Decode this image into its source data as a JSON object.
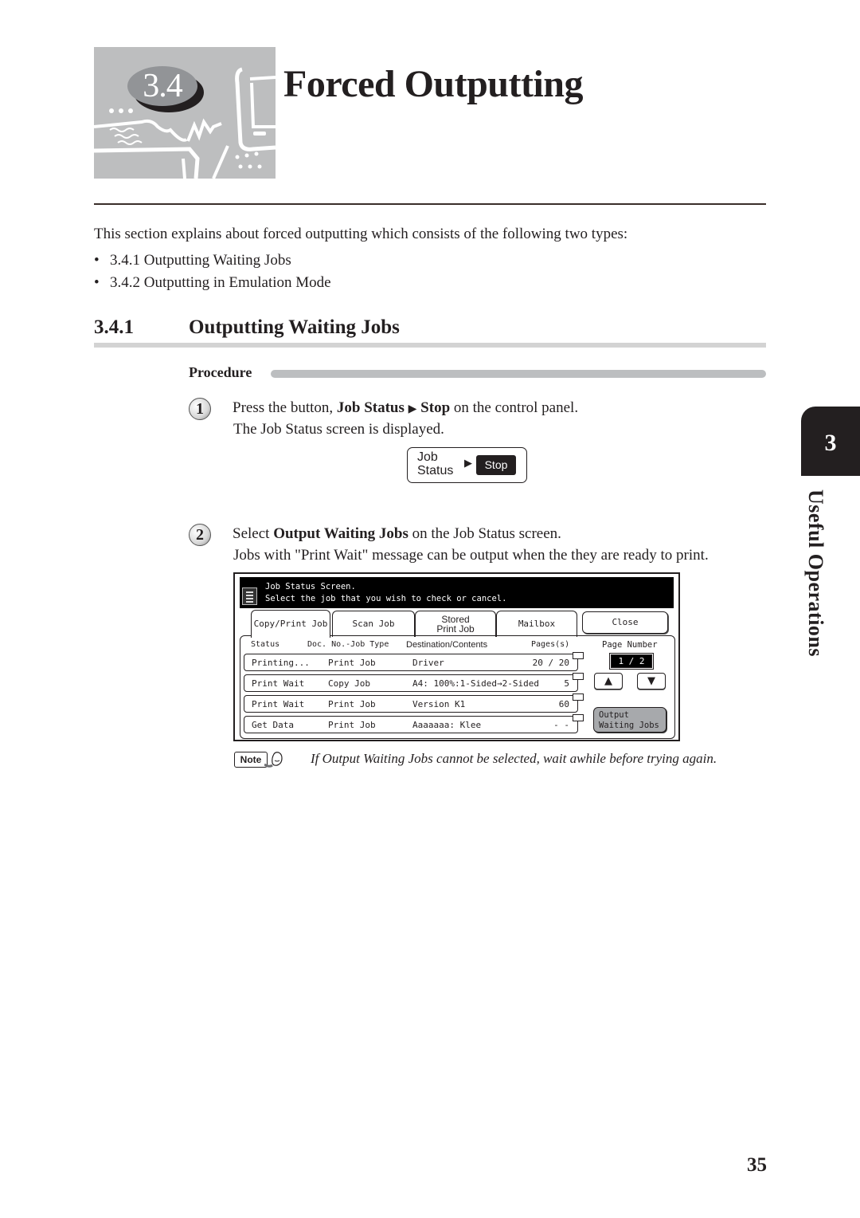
{
  "chapter": {
    "number": "3.4",
    "title": "Forced Outputting",
    "illustration_icon": "office-equipment-illustration"
  },
  "intro": {
    "text": "This section explains about forced outputting which consists of the following two types:",
    "bullet_symbol": "•",
    "bullets": [
      "3.4.1 Outputting Waiting Jobs",
      "3.4.2 Outputting in Emulation Mode"
    ]
  },
  "section": {
    "number": "3.4.1",
    "title": "Outputting Waiting Jobs",
    "procedure_label": "Procedure"
  },
  "steps": [
    {
      "number": "1",
      "line1_prefix": "Press the button, ",
      "line1_bold1": "Job Status",
      "line1_arrow": "▶",
      "line1_bold2": "Stop",
      "line1_suffix": " on the control panel.",
      "line2": "The Job Status screen is displayed."
    },
    {
      "number": "2",
      "line1_prefix": "Select ",
      "line1_bold": "Output Waiting Jobs",
      "line1_suffix": " on the Job Status screen.",
      "line2": "Jobs with \"Print Wait\" message can be output when the they are ready to print."
    }
  ],
  "control_panel": {
    "job_status_line1": "Job",
    "job_status_line2": "Status",
    "arrow": "▶",
    "stop_label": "Stop"
  },
  "job_status_screen": {
    "header_line1": "Job Status Screen.",
    "header_line2": "Select the job that you wish to check or cancel.",
    "tabs": [
      {
        "label": "Copy/Print Job",
        "active": true
      },
      {
        "label": "Scan Job",
        "active": false
      },
      {
        "label_line1": "Stored",
        "label_line2": "Print Job",
        "active": false
      },
      {
        "label": "Mailbox",
        "active": false
      }
    ],
    "close_label": "Close",
    "columns": [
      "Status",
      "Doc. No.-Job Type",
      "Destination/Contents",
      "Pages(s)"
    ],
    "rows": [
      {
        "status": "Printing...",
        "job_type": "Print Job",
        "destination": "Driver",
        "pages": "20 / 20"
      },
      {
        "status": "Print Wait",
        "job_type": "Copy Job",
        "destination": "A4: 100%:1-Sided→2-Sided",
        "pages": "5"
      },
      {
        "status": "Print Wait",
        "job_type": "Print Job",
        "destination": "Version K1",
        "pages": "60"
      },
      {
        "status": "Get Data",
        "job_type": "Print Job",
        "destination": "Aaaaaaa: Klee",
        "pages": "- -"
      }
    ],
    "page_number_label": "Page Number",
    "page_number_value": "1 / 2",
    "page_up_symbol": "▲",
    "page_down_symbol": "▼",
    "output_button_line1": "Output",
    "output_button_line2": "Waiting Jobs"
  },
  "note": {
    "badge": "Note",
    "text": "If Output Waiting Jobs cannot be selected, wait awhile before trying again."
  },
  "side_tab": {
    "chapter_number": "3",
    "chapter_label": "Useful Operations"
  },
  "page_number": "35"
}
